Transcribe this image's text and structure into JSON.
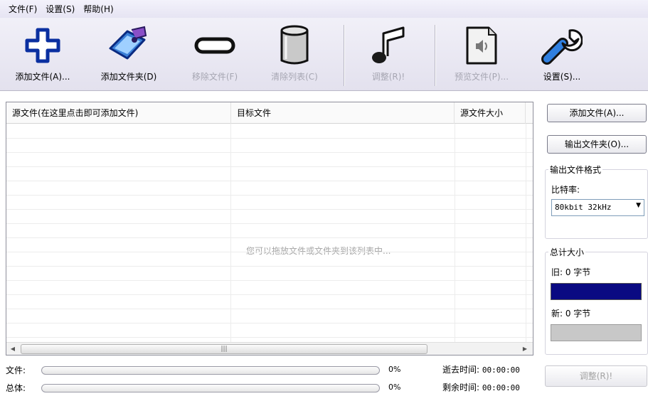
{
  "menu": {
    "file": "文件(F)",
    "settings": "设置(S)",
    "help": "帮助(H)"
  },
  "toolbar": {
    "add_file": "添加文件(A)...",
    "add_folder": "添加文件夹(D)",
    "remove_file": "移除文件(F)",
    "clear_list": "清除列表(C)",
    "adjust": "调整(R)!",
    "preview": "预览文件(P)...",
    "settings": "设置(S)..."
  },
  "list": {
    "columns": [
      "源文件(在这里点击即可添加文件)",
      "目标文件",
      "源文件大小"
    ],
    "hint": "您可以拖放文件或文件夹到该列表中..."
  },
  "right": {
    "add_file_btn": "添加文件(A)...",
    "output_folder_btn": "输出文件夹(O)...",
    "format_group": "输出文件格式",
    "bitrate_label": "比特率:",
    "bitrate_value": "80kbit 32kHz",
    "size_group": "总计大小",
    "old_label": "旧: 0 字节",
    "new_label": "新: 0 字节",
    "adjust_btn": "调整(R)!"
  },
  "progress": {
    "file_label": "文件:",
    "total_label": "总体:",
    "file_pct": "0%",
    "total_pct": "0%",
    "elapsed_label": "逝去时间:",
    "elapsed_value": "00:00:00",
    "remaining_label": "剩余时间:",
    "remaining_value": "00:00:00"
  }
}
